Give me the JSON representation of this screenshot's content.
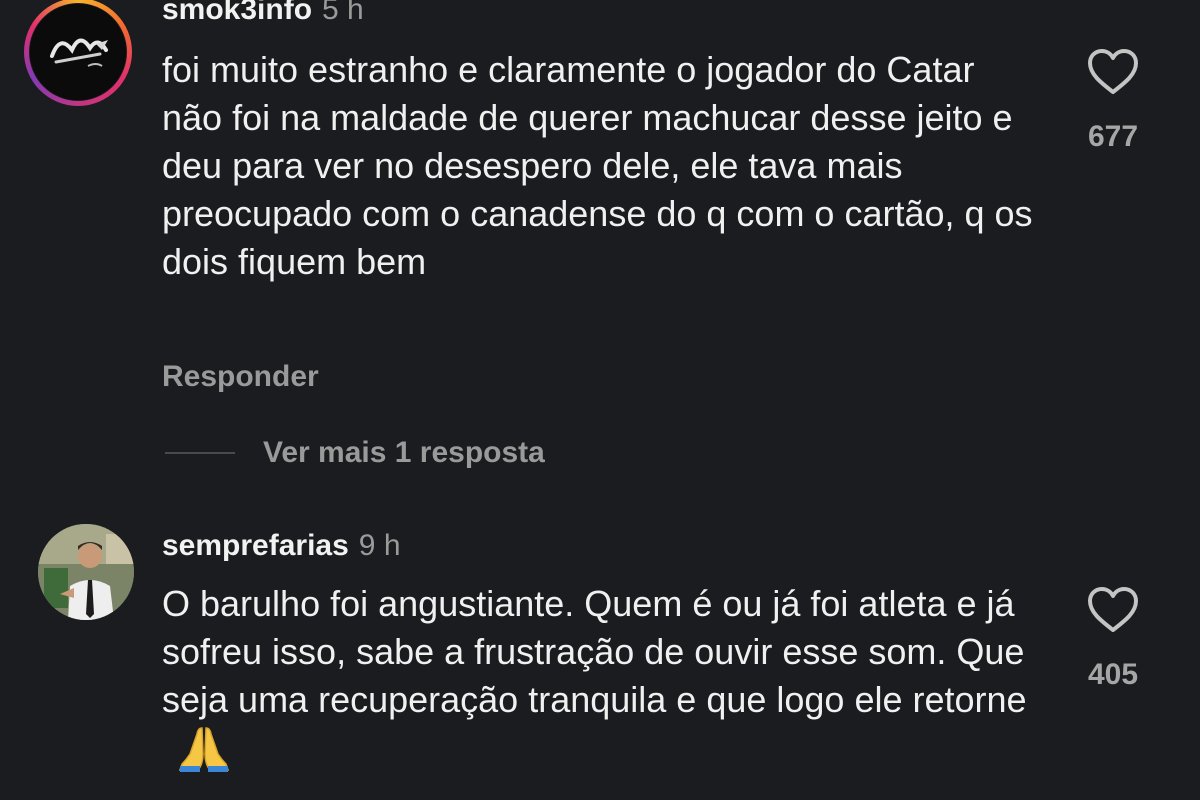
{
  "comments": [
    {
      "username": "smok3info",
      "time": "5 h",
      "text": "foi muito estranho e claramente o jogador do Catar não foi na maldade de querer machucar desse jeito e deu para ver no desespero dele, ele tava mais preocupado com o canadense do q com o cartão, q os dois fiquem bem",
      "reply_label": "Responder",
      "like_count": "677",
      "avatar_icon": "smoke-logo-avatar",
      "has_story_ring": true
    },
    {
      "username": "semprefarias",
      "time": "9 h",
      "text": "O barulho foi angustiante. Quem é ou já foi atleta e já sofreu isso, sabe a frustração de ouvir esse som. Que seja uma recuperação tranquila e que logo ele retorne",
      "emoji": "folded-hands-icon",
      "like_count": "405",
      "avatar_icon": "person-photo-avatar",
      "has_story_ring": false
    }
  ],
  "more_replies_label": "Ver mais 1 resposta",
  "colors": {
    "background": "#1b1c1f",
    "text": "#f0f0f0",
    "muted": "#9a9a9a"
  }
}
